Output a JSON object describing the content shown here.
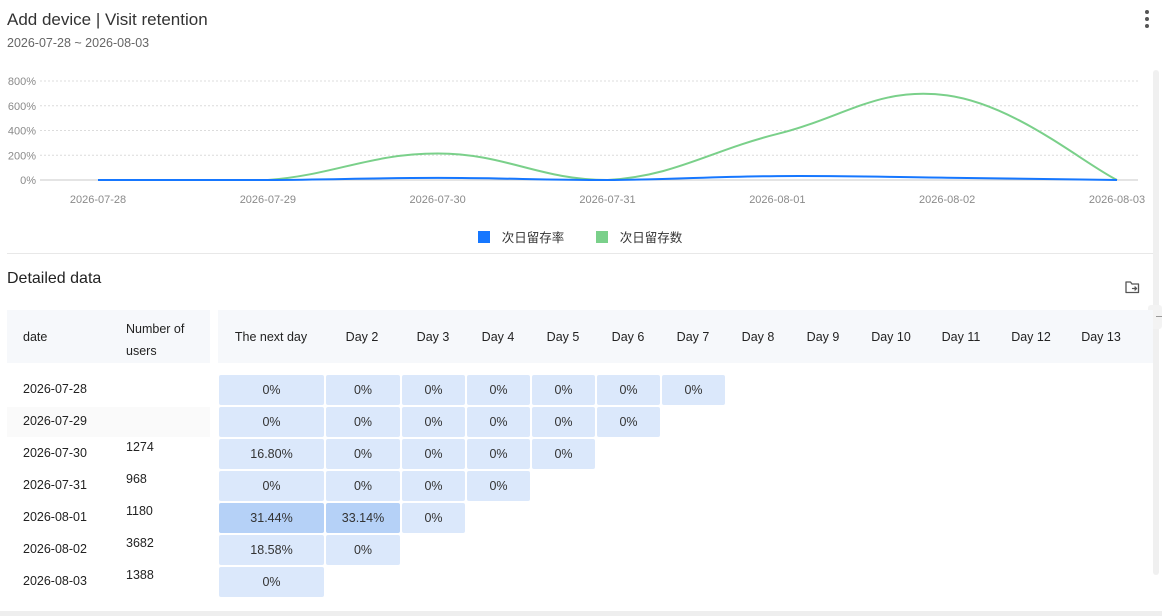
{
  "header": {
    "title": "Add device | Visit retention",
    "date_range": "2026-07-28 ~ 2026-08-03",
    "more_icon": "more-vertical-icon"
  },
  "chart_data": {
    "type": "line",
    "x": [
      "2026-07-28",
      "2026-07-29",
      "2026-07-30",
      "2026-07-31",
      "2026-08-01",
      "2026-08-02",
      "2026-08-03"
    ],
    "y_ticks": [
      "800%",
      "600%",
      "400%",
      "200%",
      "0%"
    ],
    "ylim": [
      0,
      800
    ],
    "grid": true,
    "legend_position": "bottom-center",
    "smooth": true,
    "series": [
      {
        "name": "次日留存率",
        "color": "#1677ff",
        "values": [
          0,
          0,
          16.8,
          0,
          31.44,
          18.58,
          0
        ]
      },
      {
        "name": "次日留存数",
        "color": "#7ad08a",
        "values": [
          0,
          0,
          214,
          0,
          372,
          684,
          0
        ]
      }
    ]
  },
  "section": {
    "title": "Detailed data",
    "export_icon": "export-icon"
  },
  "table": {
    "col_date": "date",
    "col_users": "Number of users",
    "day_columns": [
      "The next day",
      "Day 2",
      "Day 3",
      "Day 4",
      "Day 5",
      "Day 6",
      "Day 7",
      "Day 8",
      "Day 9",
      "Day 10",
      "Day 11",
      "Day 12",
      "Day 13"
    ],
    "rows": [
      {
        "date": "2026-07-28",
        "users": "",
        "cells": [
          "0%",
          "0%",
          "0%",
          "0%",
          "0%",
          "0%",
          "0%"
        ]
      },
      {
        "date": "2026-07-29",
        "users": "",
        "cells": [
          "0%",
          "0%",
          "0%",
          "0%",
          "0%",
          "0%"
        ]
      },
      {
        "date": "2026-07-30",
        "users": "1274",
        "cells": [
          "16.80%",
          "0%",
          "0%",
          "0%",
          "0%"
        ]
      },
      {
        "date": "2026-07-31",
        "users": "968",
        "cells": [
          "0%",
          "0%",
          "0%",
          "0%"
        ]
      },
      {
        "date": "2026-08-01",
        "users": "1180",
        "cells": [
          "31.44%",
          "33.14%",
          "0%"
        ]
      },
      {
        "date": "2026-08-02",
        "users": "3682",
        "cells": [
          "18.58%",
          "0%"
        ]
      },
      {
        "date": "2026-08-03",
        "users": "1388",
        "cells": [
          "0%"
        ]
      }
    ],
    "colors": {
      "cell_light": "#dbe8fb",
      "cell_strong": "#b5d1f7"
    }
  }
}
